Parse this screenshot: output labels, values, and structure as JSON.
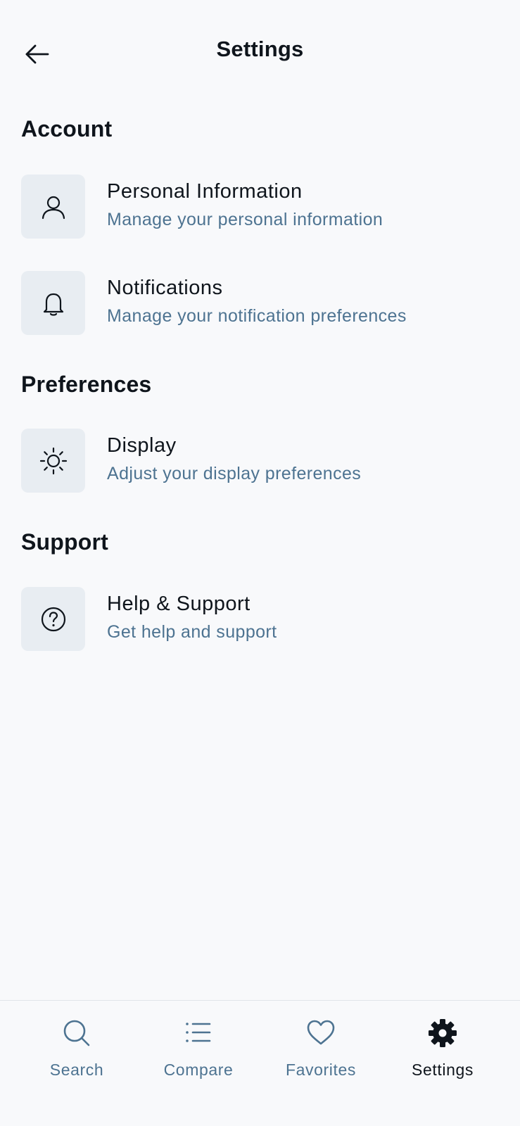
{
  "colors": {
    "background": "#f8f9fb",
    "text_primary": "#0f151c",
    "text_secondary": "#4d7391",
    "icon_tile": "#e8edf2",
    "tab_inactive": "#4d7391",
    "tab_active": "#0f151c"
  },
  "header": {
    "title": "Settings",
    "back_icon": "arrow-left-icon"
  },
  "sections": [
    {
      "title": "Account",
      "items": [
        {
          "icon": "user-icon",
          "title": "Personal Information",
          "subtitle": "Manage your personal information"
        },
        {
          "icon": "bell-icon",
          "title": "Notifications",
          "subtitle": "Manage your notification preferences"
        }
      ]
    },
    {
      "title": "Preferences",
      "items": [
        {
          "icon": "sun-icon",
          "title": "Display",
          "subtitle": "Adjust your display preferences"
        }
      ]
    },
    {
      "title": "Support",
      "items": [
        {
          "icon": "question-circle-icon",
          "title": "Help & Support",
          "subtitle": "Get help and support"
        }
      ]
    }
  ],
  "tabbar": {
    "tabs": [
      {
        "label": "Search",
        "icon": "search-icon",
        "active": false
      },
      {
        "label": "Compare",
        "icon": "list-icon",
        "active": false
      },
      {
        "label": "Favorites",
        "icon": "heart-icon",
        "active": false
      },
      {
        "label": "Settings",
        "icon": "gear-icon",
        "active": true
      }
    ]
  }
}
